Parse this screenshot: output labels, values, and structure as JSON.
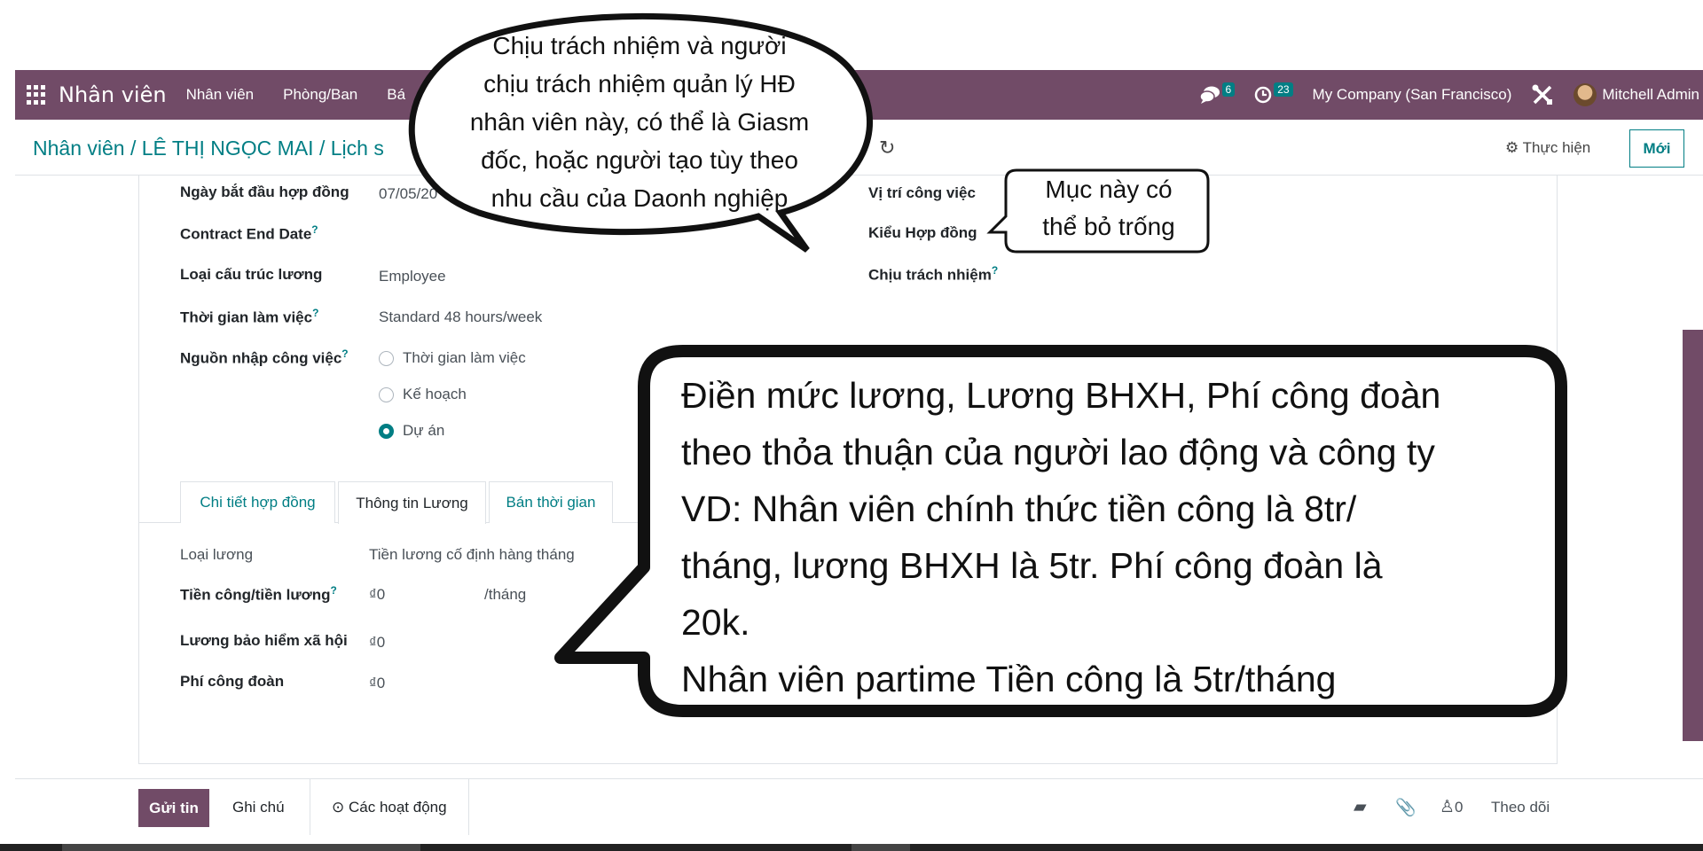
{
  "navbar": {
    "app_name": "Nhân viên",
    "menus": [
      "Nhân viên",
      "Phòng/Ban",
      "Bá"
    ],
    "messages_count": "6",
    "activities_count": "23",
    "company": "My Company (San Francisco)",
    "user": "Mitchell Admin",
    "bar_color": "#714b67"
  },
  "control": {
    "breadcrumb": "Nhân viên / LÊ THỊ NGỌC MAI / Lịch s",
    "action_label": "⚙ Thực hiện",
    "new_label": "Mới"
  },
  "form": {
    "start_date_label": "Ngày bắt đầu hợp đồng",
    "start_date_value": "07/05/20",
    "end_date_label": "Contract End Date",
    "salary_structure_label": "Loại cấu trúc lương",
    "salary_structure_value": "Employee",
    "work_time_label": "Thời gian làm việc",
    "work_time_value": "Standard 48 hours/week",
    "work_source_label": "Nguồn nhập công việc",
    "work_source_options": [
      "Thời gian làm việc",
      "Kế hoạch",
      "Dự án"
    ],
    "work_source_selected": "Dự án",
    "job_position_label": "Vị trí công việc",
    "contract_type_label": "Kiểu Hợp đồng",
    "responsible_label": "Chịu trách nhiệm",
    "tooltip_mark": "?"
  },
  "tabs": [
    "Chi tiết hợp đồng",
    "Thông tin Lương",
    "Bán thời gian"
  ],
  "active_tab": "Thông tin Lương",
  "salary": {
    "wage_type_label": "Loại lương",
    "wage_type_value": "Tiền lương cố định hàng tháng",
    "wage_label": "Tiền công/tiền lương",
    "wage_value": "₫0",
    "wage_unit": "/tháng",
    "insurance_label": "Lương bảo hiểm xã hội",
    "insurance_value": "₫0",
    "union_fee_label": "Phí công đoàn",
    "union_fee_value": "₫0"
  },
  "chatter": {
    "send_label": "Gửi tin",
    "note_label": "Ghi chú",
    "activities_label": "Các hoạt động",
    "followers_count": "0",
    "follow_label": "Theo dõi"
  },
  "callouts": {
    "responsible_note": [
      "Chịu trách nhiệm và người",
      "chịu trách nhiệm quản lý HĐ",
      "nhân viên này, có thể là Giasm",
      "đốc, hoặc người tạo tùy theo",
      "nhu cầu của Daonh nghiệp"
    ],
    "optional_note": [
      "Mục này có",
      "thể bỏ trống"
    ],
    "salary_note": [
      "Điền mức lương, Lương BHXH, Phí công đoàn",
      "theo thỏa thuận của người lao động và công ty",
      "VD: Nhân viên chính thức tiền công là 8tr/",
      "tháng, lương BHXH là 5tr. Phí công đoàn là",
      "20k.",
      "Nhân viên partime Tiền công là 5tr/tháng"
    ]
  },
  "icons": {
    "apps": "apps-grid-icon",
    "messages": "chat-icon",
    "activities": "clock-icon",
    "tools": "tools-icon",
    "refresh": "refresh-icon",
    "notebook": "notebook-icon",
    "paperclip": "paperclip-icon",
    "followers": "user-icon"
  },
  "colors": {
    "primary": "#714b67",
    "accent": "#017e84"
  }
}
